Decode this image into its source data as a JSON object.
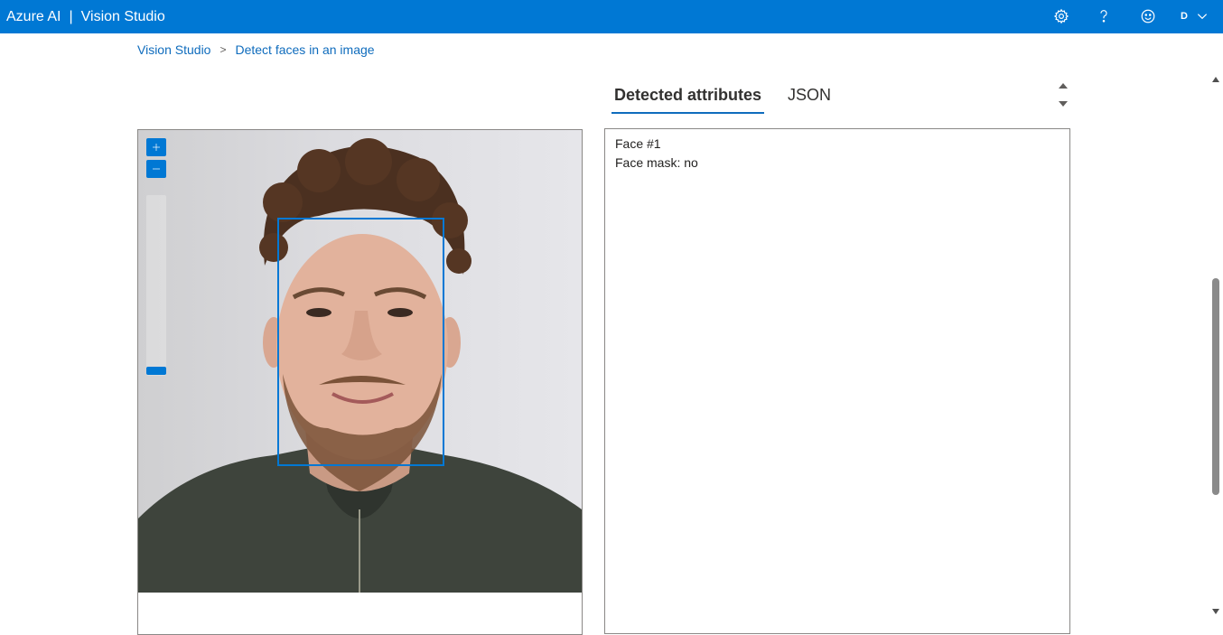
{
  "header": {
    "product": "Azure AI",
    "separator": "|",
    "app": "Vision Studio",
    "account_initial": "D",
    "icons": [
      "gear-icon",
      "help-icon",
      "smile-icon",
      "chevron-down-icon"
    ]
  },
  "breadcrumb": {
    "root": "Vision Studio",
    "separator": ">",
    "current": "Detect faces in an image"
  },
  "tabs": [
    {
      "label": "Detected attributes",
      "active": true
    },
    {
      "label": "JSON",
      "active": false
    }
  ],
  "results": {
    "face_title": "Face #1",
    "face_mask": "Face mask: no"
  },
  "colors": {
    "accent": "#0078d4",
    "link": "#0f6cbd"
  }
}
